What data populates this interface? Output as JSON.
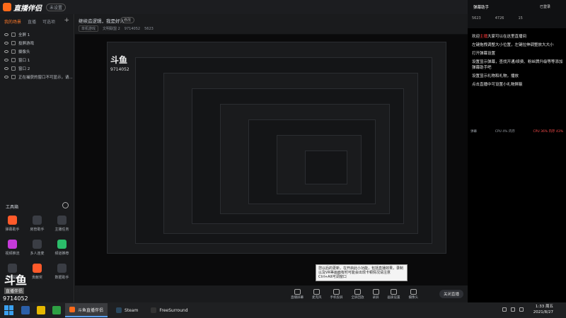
{
  "app": {
    "title": "直播伴侣",
    "version": "未设置",
    "login": "已登录"
  },
  "left": {
    "tabs": [
      "我的场景",
      "直播",
      "可选项"
    ],
    "sources": [
      "全屏 1",
      "投屏游戏",
      "摄像头",
      "窗口 1",
      "窗口 2",
      "正在捕获的窗口不可显示，请..."
    ],
    "toolbox_title": "工具箱",
    "tools": [
      {
        "label": "弹幕助手",
        "color": "#ff5a2a"
      },
      {
        "label": "房管助手",
        "color": "#3a3d44"
      },
      {
        "label": "主播任务",
        "color": "#3a3d44"
      },
      {
        "label": "视频推流",
        "color": "#c53ad9"
      },
      {
        "label": "多人连麦",
        "color": "#3a3d44"
      },
      {
        "label": "频道推荐",
        "color": "#2bbd6a"
      },
      {
        "label": "开播提醒",
        "color": "#3a3d44"
      },
      {
        "label": "贡献奖",
        "color": "#ff5a2a"
      },
      {
        "label": "数据助手",
        "color": "#3a3d44"
      }
    ],
    "brand_logo": "斗鱼",
    "brand_sub": "直播伴侣",
    "room_id": "9714052"
  },
  "center": {
    "stream_title": "继续造逻辑，我是好人",
    "edit_label": "修改",
    "meta": [
      "单机游戏",
      "文明联盟 2",
      "9714052",
      "5623"
    ],
    "watermark": "斗鱼",
    "watermark_id": "9714052",
    "notice_text": "您以后的更新，在开启此小功能，包括直播效果，录制以及VR等画面有时可能会出现卡顿情况请注意 Ctrl+Alt可调窗口",
    "controls": [
      "直播屏幕",
      "麦克风",
      "手机投屏",
      "全屏回放",
      "录屏",
      "画质设置",
      "摄像头"
    ],
    "start_label": "关闭直播"
  },
  "right": {
    "user": "弹幕助手",
    "stats": [
      "5623",
      "4726",
      "15"
    ],
    "messages": [
      {
        "prefix": "欢迎",
        "name": "主播",
        "text": "大家可以在这里直播间"
      },
      {
        "prefix": "",
        "name": "",
        "text": "左键拖拽调整大小位置，左键拉伸调整放大大小"
      },
      {
        "prefix": "",
        "name": "",
        "text": "打开弹幕设置"
      },
      {
        "prefix": "",
        "name": "",
        "text": "设置显示弹幕，查找开通/续费、粉丝牌升级等等添加弹幕助手吧"
      },
      {
        "prefix": "",
        "name": "",
        "text": "设置显示礼物和礼物，播放"
      },
      {
        "prefix": "",
        "name": "",
        "text": "点击直播中可设置小礼物屏蔽"
      }
    ],
    "footer_left": "弹幕",
    "footer_mid": "CPU 4% 内存",
    "footer_right": "CPU 36% 内存 43%"
  },
  "taskbar": {
    "apps": [
      {
        "label": "斗鱼直播伴侣",
        "color": "#ff6a1a",
        "active": true
      },
      {
        "label": "Steam",
        "color": "#2a475e",
        "active": false
      },
      {
        "label": "FreeSurround",
        "color": "#333",
        "active": false
      }
    ],
    "time": "1:33 周五",
    "date": "2021/8/27"
  }
}
